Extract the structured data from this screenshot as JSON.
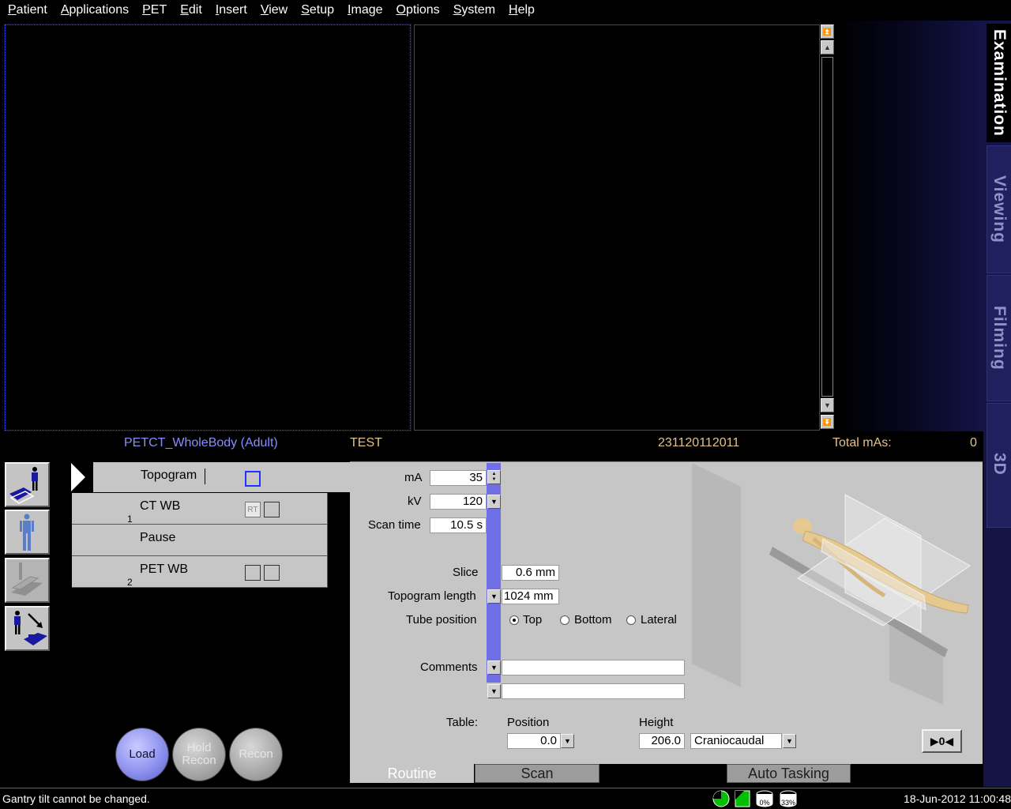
{
  "menu": [
    "Patient",
    "Applications",
    "PET",
    "Edit",
    "Insert",
    "View",
    "Setup",
    "Image",
    "Options",
    "System",
    "Help"
  ],
  "side_tabs": {
    "examination": "Examination",
    "viewing": "Viewing",
    "filming": "Filming",
    "three_d": "3D"
  },
  "info": {
    "protocol": "PETCT_WholeBody (Adult)",
    "patient_name": "TEST",
    "patient_id": "231120112011",
    "total_mas_label": "Total mAs:",
    "total_mas_value": "0"
  },
  "ranges": [
    {
      "name": "Topogram",
      "number": ""
    },
    {
      "name": "CT WB",
      "number": "1",
      "rt_label": "RT"
    },
    {
      "name": "Pause",
      "number": ""
    },
    {
      "name": "PET WB",
      "number": "2"
    }
  ],
  "buttons": {
    "load": "Load",
    "hold_recon": "Hold Recon",
    "recon": "Recon"
  },
  "params": {
    "ma_label": "mA",
    "ma_value": "35",
    "kv_label": "kV",
    "kv_value": "120",
    "scan_time_label": "Scan time",
    "scan_time_value": "10.5 s",
    "slice_label": "Slice",
    "slice_value": "0.6 mm",
    "topo_length_label": "Topogram length",
    "topo_length_value": "1024 mm",
    "tube_position_label": "Tube position",
    "tube_options": [
      "Top",
      "Bottom",
      "Lateral"
    ],
    "tube_selected": "Top",
    "comments_label": "Comments",
    "comment1": "",
    "comment2": "",
    "table_label": "Table:",
    "position_label": "Position",
    "position_value": "0.0",
    "height_label": "Height",
    "height_value": "206.0",
    "direction_value": "Craniocaudal",
    "move_button": "▶0◀"
  },
  "bottom_tabs": {
    "routine": "Routine",
    "scan": "Scan",
    "auto_tasking": "Auto Tasking"
  },
  "status": {
    "message": "Gantry tilt cannot be changed.",
    "disk1": "0%",
    "disk2": "33%",
    "datetime": "18-Jun-2012 11:00:48"
  },
  "colors": {
    "protocol_text": "#8a8cff",
    "info_text": "#e2c289",
    "side_tab_bg": "#20205e",
    "panel_bg": "#c6c6c6",
    "selection_strip": "#6f6fe8"
  }
}
